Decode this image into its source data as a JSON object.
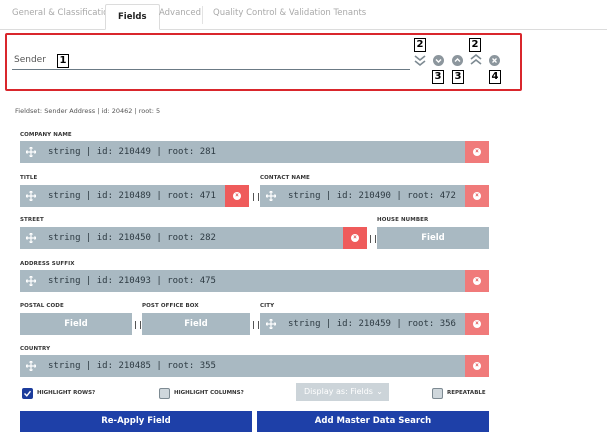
{
  "tabs": [
    {
      "label": "General & Classification",
      "active": false
    },
    {
      "label": "Fields",
      "active": true
    },
    {
      "label": "Advanced",
      "active": false
    },
    {
      "label": "Quality Control & Validation Tenants",
      "active": false
    }
  ],
  "header": {
    "sender_label": "Sender",
    "annotations": {
      "a1": "1",
      "a2_left": "2",
      "a3_left": "3",
      "a3_right": "3",
      "a2_right": "2",
      "a4": "4"
    },
    "icons": [
      "double-chevron-down-icon",
      "chevron-down-circle-icon",
      "chevron-up-circle-icon",
      "double-chevron-up-icon",
      "close-circle-icon"
    ]
  },
  "fieldset_info": "Fieldset: Sender Address | id: 20462 | root: 5",
  "fields": {
    "company_name": {
      "label": "COMPANY NAME",
      "value": "string | id: 210449 | root: 281"
    },
    "title": {
      "label": "TITLE",
      "value": "string | id: 210489 | root: 471"
    },
    "contact_name": {
      "label": "CONTACT NAME",
      "value": "string | id: 210490 | root: 472"
    },
    "street": {
      "label": "STREET",
      "value": "string | id: 210450 | root: 282"
    },
    "house_number": {
      "label": "HOUSE NUMBER",
      "button": "Field"
    },
    "address_suffix": {
      "label": "ADDRESS SUFFIX",
      "value": "string | id: 210493 | root: 475"
    },
    "postal_code": {
      "label": "POSTAL CODE",
      "button": "Field"
    },
    "post_office_box": {
      "label": "POST OFFICE BOX",
      "button": "Field"
    },
    "city": {
      "label": "CITY",
      "value": "string | id: 210459 | root: 356"
    },
    "country": {
      "label": "COUNTRY",
      "value": "string | id: 210485 | root: 355"
    }
  },
  "options": {
    "highlight_rows": {
      "label": "HIGHLIGHT ROWS?",
      "checked": true
    },
    "highlight_columns": {
      "label": "HIGHLIGHT COLUMNS?",
      "checked": false
    },
    "display_as": "Display as: Fields",
    "repeatable": {
      "label": "REPEATABLE",
      "checked": false
    }
  },
  "buttons": {
    "reapply": "Re-Apply Field",
    "add_master": "Add Master Data Search"
  },
  "colors": {
    "accent": "#1e40a8",
    "remove": "#f07a7a",
    "field_bar": "#a9b9c2",
    "highlight_border": "#d9262c"
  }
}
